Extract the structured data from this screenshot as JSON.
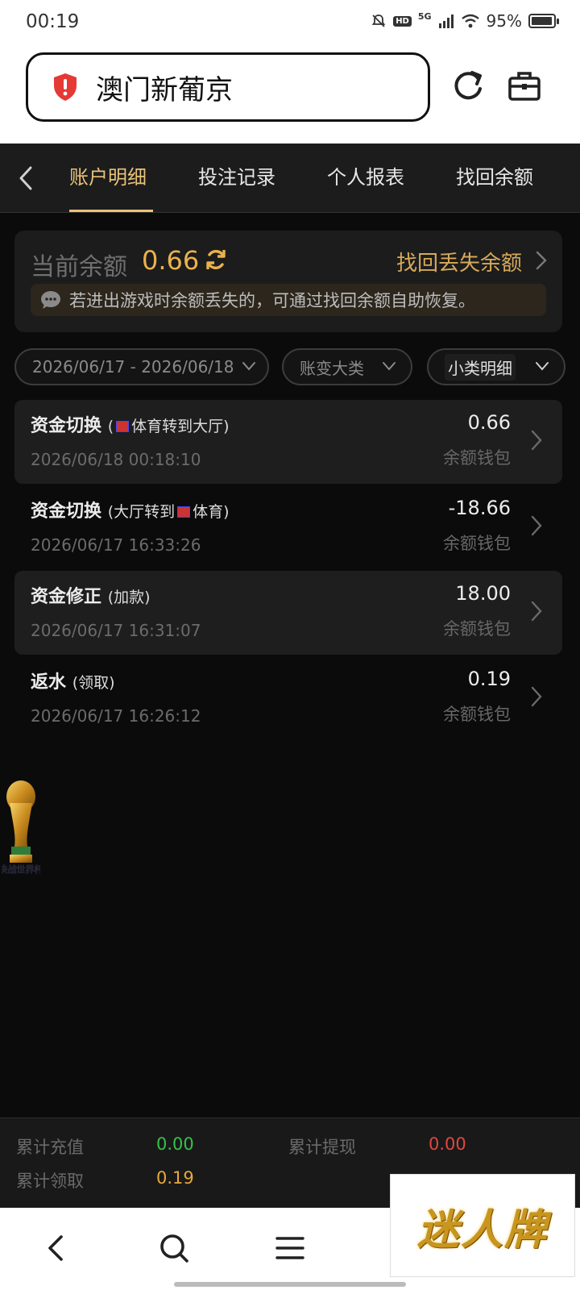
{
  "status_bar": {
    "time": "00:19",
    "battery_percent": "95%",
    "network": "5G",
    "hd": "HD"
  },
  "browser": {
    "url_text": "澳门新葡京",
    "icons": [
      "shield-warning-icon",
      "reload-icon",
      "toolbox-icon"
    ]
  },
  "tabs": [
    {
      "label": "账户明细",
      "active": true
    },
    {
      "label": "投注记录",
      "active": false
    },
    {
      "label": "个人报表",
      "active": false
    },
    {
      "label": "找回余额",
      "active": false
    }
  ],
  "balance": {
    "label": "当前余额",
    "value": "0.66",
    "recover_link": "找回丢失余额",
    "notice": "若进出游戏时余额丢失的，可通过找回余额自助恢复。"
  },
  "filters": {
    "date_range": "2026/06/17 - 2026/06/18",
    "category": "账变大类",
    "subcategory": "小类明细"
  },
  "transactions": [
    {
      "title": "资金切换",
      "sub_pre": "(",
      "sub_post": "体育转到大厅)",
      "flag_position": "start",
      "date": "2026/06/18 00:18:10",
      "amount": "0.66",
      "wallet": "余额钱包",
      "shaded": true
    },
    {
      "title": "资金切换",
      "sub_pre": "(大厅转到",
      "sub_post": "体育)",
      "flag_position": "middle",
      "date": "2026/06/17 16:33:26",
      "amount": "-18.66",
      "wallet": "余额钱包",
      "shaded": false
    },
    {
      "title": "资金修正",
      "sub_pre": "(加款)",
      "sub_post": "",
      "flag_position": "none",
      "date": "2026/06/17 16:31:07",
      "amount": "18.00",
      "wallet": "余额钱包",
      "shaded": true
    },
    {
      "title": "返水",
      "sub_pre": "(领取)",
      "sub_post": "",
      "flag_position": "none",
      "date": "2026/06/17 16:26:12",
      "amount": "0.19",
      "wallet": "余额钱包",
      "shaded": false
    }
  ],
  "floating_badge": {
    "text": "决战世界杯"
  },
  "summary": {
    "total_deposit_label": "累计充值",
    "total_deposit_value": "0.00",
    "total_withdraw_label": "累计提现",
    "total_withdraw_value": "0.00",
    "total_claim_label": "累计领取",
    "total_claim_value": "0.19",
    "colors": {
      "deposit": "#35c24a",
      "withdraw": "#e0473f",
      "claim": "#e8a93a"
    }
  },
  "watermark": {
    "text": "迷人牌"
  },
  "nav_icons": [
    "back-icon",
    "search-icon",
    "menu-icon"
  ]
}
